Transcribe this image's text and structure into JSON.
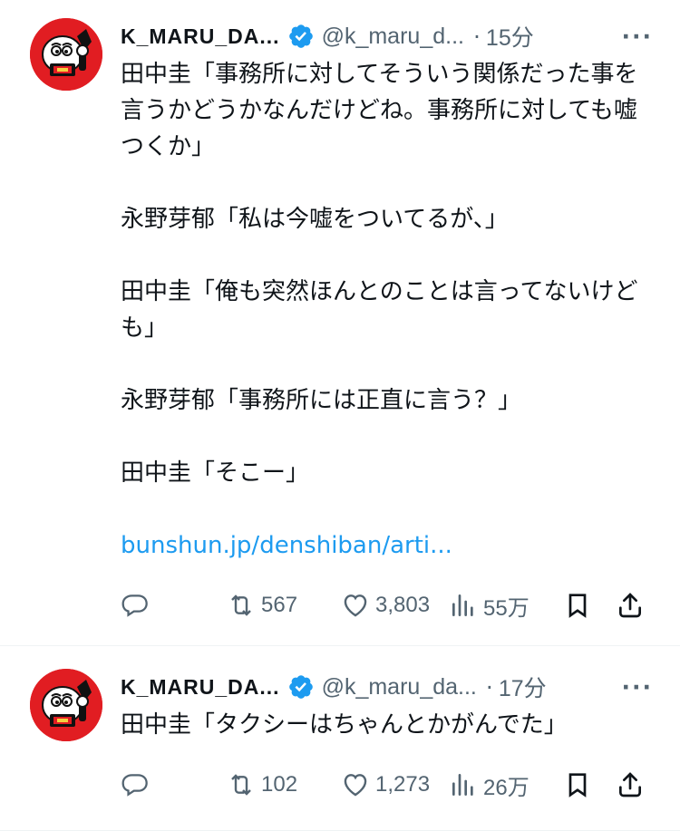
{
  "colors": {
    "accent": "#1d9bf0",
    "muted": "#536471",
    "text": "#0f1419",
    "avatar_bg": "#e11d22"
  },
  "tweets": [
    {
      "name": "K_MARU_DA...",
      "handle": "@k_maru_d...",
      "dot": "·",
      "time": "15分",
      "more": "···",
      "paragraphs": [
        "田中圭「事務所に対してそういう関係だった事を言うかどうかなんだけどね。事務所に対しても嘘つくか」",
        "永野芽郁「私は今嘘をついてるが、」",
        "田中圭「俺も突然ほんとのことは言ってないけども」",
        "永野芽郁「事務所には正直に言う？」",
        "田中圭「そこー」"
      ],
      "link": "bunshun.jp/denshiban/arti...",
      "retweets": "567",
      "likes": "3,803",
      "views": "55万"
    },
    {
      "name": "K_MARU_DA...",
      "handle": "@k_maru_da...",
      "dot": "·",
      "time": "17分",
      "more": "···",
      "paragraphs": [
        "田中圭「タクシーはちゃんとかがんでた」"
      ],
      "retweets": "102",
      "likes": "1,273",
      "views": "26万"
    }
  ],
  "icons": {
    "reply": "reply-icon",
    "retweet": "retweet-icon",
    "like": "heart-icon",
    "views": "views-icon",
    "bookmark": "bookmark-icon",
    "share": "share-icon",
    "verified": "verified-badge-icon",
    "more": "more-options-icon"
  }
}
